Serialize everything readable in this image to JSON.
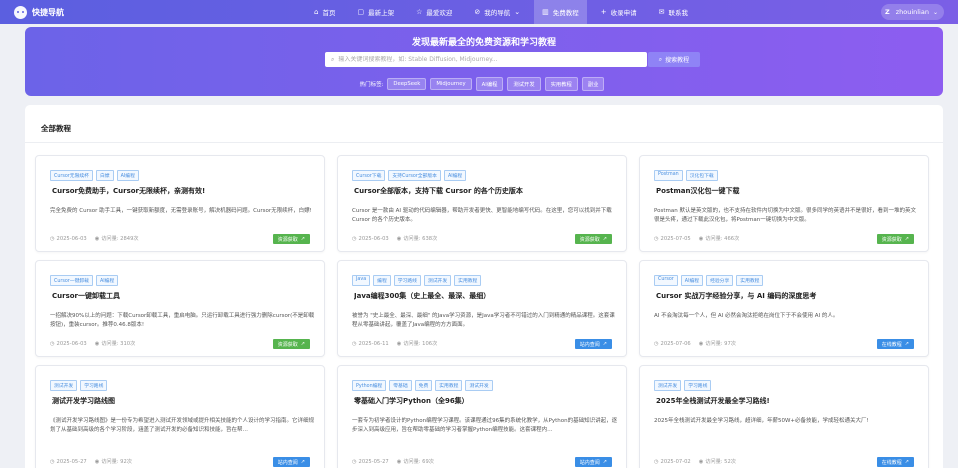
{
  "brand": {
    "name": "快捷导航"
  },
  "nav": [
    {
      "label": "首页",
      "icon": "home-icon",
      "glyph": "⌂",
      "active": false
    },
    {
      "label": "最新上架",
      "icon": "box-icon",
      "glyph": "▢",
      "active": false
    },
    {
      "label": "最爱欢迎",
      "icon": "star-icon",
      "glyph": "☆",
      "active": false
    },
    {
      "label": "我的导航",
      "icon": "compass-icon",
      "glyph": "⊘",
      "active": false,
      "dropdown": true
    },
    {
      "label": "免费教程",
      "icon": "book-icon",
      "glyph": "▥",
      "active": true
    },
    {
      "label": "收录申请",
      "icon": "plus-icon",
      "glyph": "+",
      "active": false
    },
    {
      "label": "联系我",
      "icon": "mail-icon",
      "glyph": "✉",
      "active": false
    }
  ],
  "user": {
    "avatar": "Z",
    "name": "zhouinlian"
  },
  "hero": {
    "title": "发现最新最全的免费资源和学习教程",
    "search_placeholder": "输入关键词搜索教程，如: Stable Diffusion, Midjourney...",
    "search_button": "搜索教程",
    "hot_label": "热门标签:",
    "hot_tags": [
      "DeepSeek",
      "Midjourney",
      "AI编程",
      "测试开发",
      "实用教程",
      "副业"
    ]
  },
  "section_title": "全部教程",
  "cards": [
    {
      "tags": [
        "Cursor无限续杯",
        "白嫖",
        "AI编程"
      ],
      "title": "Cursor免费助手，Cursor无限续杯，亲测有效!",
      "desc": "完全免费的 Cursor 助手工具，一键获取新额度，无需登录账号，解决机器码问题。Cursor无限续杯，白嫖!",
      "date": "2025-06-03",
      "visits": "访问量: 2849次",
      "button": "资源获取",
      "btn_color": "#56b44e"
    },
    {
      "tags": [
        "Cursor下载",
        "支持Cursor全部版本",
        "AI编程"
      ],
      "title": "Cursor全部版本，支持下载 Cursor 的各个历史版本",
      "desc": "Cursor 是一款由 AI 驱动的代码编辑器，帮助开发者更快、更智能地编写代码。在这里，您可以找到并下载 Cursor 的各个历史版本。",
      "date": "2025-06-03",
      "visits": "访问量: 638次",
      "button": "资源获取",
      "btn_color": "#56b44e"
    },
    {
      "tags": [
        "Postman",
        "汉化包下载"
      ],
      "title": "Postman汉化包一键下载",
      "desc": "Postman 默认是英文版的，也不支持在软件内切换为中文版。很多同学的英语并不是很好，看到一堆的英文很是头疼，通过下载此汉化包，将Postman一键切换为中文版。",
      "date": "2025-07-05",
      "visits": "访问量: 466次",
      "button": "资源获取",
      "btn_color": "#56b44e"
    },
    {
      "tags": [
        "Cursor一键卸载",
        "AI编程"
      ],
      "title": "Cursor一键卸载工具",
      "desc": "一招解决90%以上的问题：下载Cursor卸载工具，重启电脑。只运行卸载工具进行强力删除cursor(不是卸载按钮)，重装cursor。推荐0.46.8版本!",
      "date": "2025-06-03",
      "visits": "访问量: 310次",
      "button": "资源获取",
      "btn_color": "#56b44e"
    },
    {
      "tags": [
        "Java",
        "编程",
        "学习路线",
        "测试开发",
        "实用教程"
      ],
      "title": "Java编程300集（史上最全、最深、最细）",
      "desc": "被誉为 \"史上最全、最深、最细\" 的Java学习资源，是Java学习者不可错过的入门到精通的精品课程。这套课程从零基础讲起，覆盖了Java编程的方方面面。",
      "date": "2025-06-11",
      "visits": "访问量: 106次",
      "button": "站内查阅",
      "btn_color": "#3a8ee6"
    },
    {
      "tags": [
        "Cursor",
        "AI编程",
        "经验分享",
        "实用教程"
      ],
      "title": "Cursor 实战万字经验分享，与 AI 编码的深度思考",
      "desc": "AI 不会淘汰每一个人，但 AI 必然会淘汰拒绝在岗位下于不会使用 AI 的人。",
      "date": "2025-07-06",
      "visits": "访问量: 97次",
      "button": "在线教程",
      "btn_color": "#3a8ee6"
    },
    {
      "tags": [
        "测试开发",
        "学习路线"
      ],
      "title": "测试开发学习路线图",
      "desc": "《测试开发学习路线图》是一份专为希望进入测试开发领域或提升相关技能的个人设计的学习指南。它详细规划了从基础到高级的各个学习阶段，涵盖了测试开发的必备知识和技能，旨在帮…",
      "date": "2025-05-27",
      "visits": "访问量: 92次",
      "button": "站内查阅",
      "btn_color": "#3a8ee6"
    },
    {
      "tags": [
        "Python编程",
        "零基础",
        "免费",
        "实用教程",
        "测试开发"
      ],
      "title": "零基础入门学习Python（全96集）",
      "desc": "一套专为初学者设计的Python编程学习课程。该课程通过96集的系统化教学，从Python的基础知识讲起，逐步深入到高级应用，旨在帮助零基础的学习者掌握Python编程技能。这套课程内…",
      "date": "2025-05-27",
      "visits": "访问量: 69次",
      "button": "站内查阅",
      "btn_color": "#3a8ee6"
    },
    {
      "tags": [
        "测试开发",
        "学习路线"
      ],
      "title": "2025年全栈测试开发最全学习路线!",
      "desc": "2025年全栈测试开发最全学习路线，超详细，年薪50W+必备技能，学成轻松通关大厂!",
      "date": "2025-07-02",
      "visits": "访问量: 52次",
      "button": "在线教程",
      "btn_color": "#3a8ee6"
    }
  ]
}
